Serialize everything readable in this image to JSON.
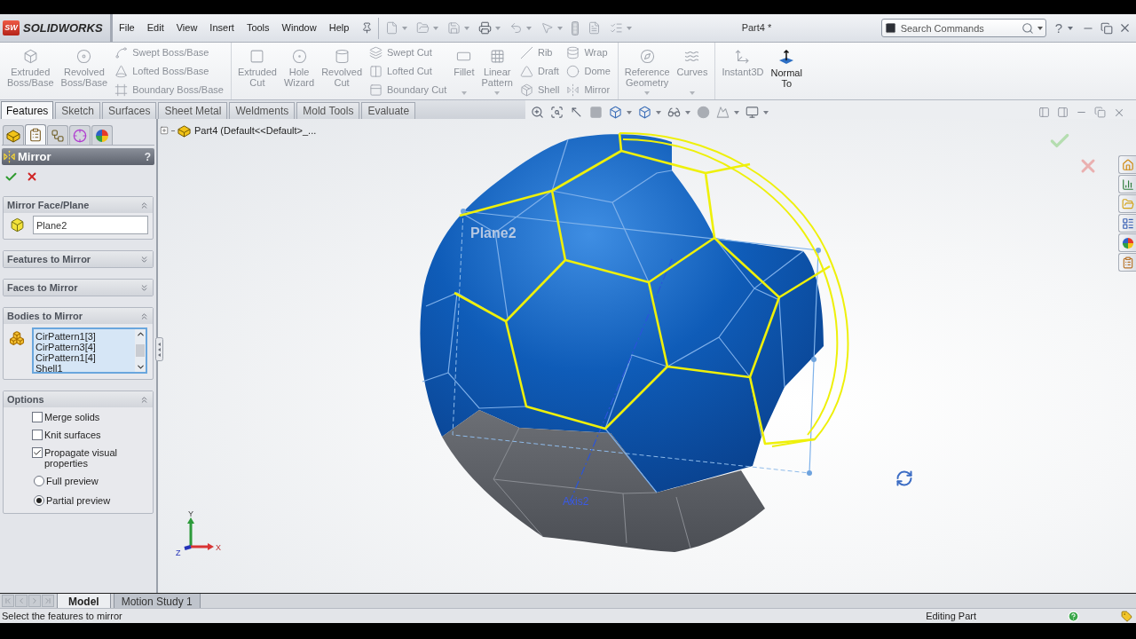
{
  "title_bar": {
    "logo_mark": "SW",
    "logo_text": "SOLIDWORKS",
    "menus": [
      "File",
      "Edit",
      "View",
      "Insert",
      "Tools",
      "Window",
      "Help"
    ],
    "document_title": "Part4 *",
    "search": {
      "placeholder": "Search Commands"
    },
    "help": "?"
  },
  "ribbon": {
    "sections": [
      {
        "columns": [
          {
            "kind": "large",
            "label": "Extruded Boss/Base",
            "disabled": true,
            "has_menu": false
          },
          {
            "kind": "large",
            "label": "Revolved Boss/Base",
            "disabled": true,
            "has_menu": false
          },
          {
            "kind": "stack",
            "items": [
              {
                "label": "Swept Boss/Base",
                "disabled": true
              },
              {
                "label": "Lofted Boss/Base",
                "disabled": true
              },
              {
                "label": "Boundary Boss/Base",
                "disabled": true
              }
            ]
          }
        ]
      },
      {
        "columns": [
          {
            "kind": "large",
            "label": "Extruded Cut",
            "disabled": true,
            "has_menu": false
          },
          {
            "kind": "large",
            "label": "Hole Wizard",
            "disabled": true,
            "has_menu": false
          },
          {
            "kind": "large",
            "label": "Revolved Cut",
            "disabled": true,
            "has_menu": false
          },
          {
            "kind": "stack",
            "items": [
              {
                "label": "Swept Cut",
                "disabled": true
              },
              {
                "label": "Lofted Cut",
                "disabled": true
              },
              {
                "label": "Boundary Cut",
                "disabled": true
              }
            ]
          },
          {
            "kind": "large",
            "label": "Fillet",
            "disabled": true,
            "has_menu": true
          },
          {
            "kind": "large",
            "label": "Linear Pattern",
            "disabled": true,
            "has_menu": true
          },
          {
            "kind": "stack",
            "items": [
              {
                "label": "Rib",
                "disabled": true
              },
              {
                "label": "Draft",
                "disabled": true
              },
              {
                "label": "Shell",
                "disabled": true
              }
            ]
          },
          {
            "kind": "stack",
            "items": [
              {
                "label": "Wrap",
                "disabled": true
              },
              {
                "label": "Dome",
                "disabled": true
              },
              {
                "label": "Mirror",
                "disabled": true
              }
            ]
          }
        ]
      },
      {
        "columns": [
          {
            "kind": "large",
            "label": "Reference Geometry",
            "disabled": true,
            "has_menu": true
          },
          {
            "kind": "large",
            "label": "Curves",
            "disabled": true,
            "has_menu": true
          }
        ]
      },
      {
        "columns": [
          {
            "kind": "large",
            "label": "Instant3D",
            "disabled": true,
            "has_menu": false
          },
          {
            "kind": "large",
            "label": "Normal To",
            "disabled": false,
            "has_menu": false
          }
        ]
      }
    ]
  },
  "command_tabs": [
    {
      "label": "Features",
      "selected": true
    },
    {
      "label": "Sketch",
      "selected": false
    },
    {
      "label": "Surfaces",
      "selected": false
    },
    {
      "label": "Sheet Metal",
      "selected": false
    },
    {
      "label": "Weldments",
      "selected": false
    },
    {
      "label": "Mold Tools",
      "selected": false
    },
    {
      "label": "Evaluate",
      "selected": false
    }
  ],
  "panel_tabs": [
    {
      "selected": false
    },
    {
      "selected": true
    },
    {
      "selected": false
    },
    {
      "selected": false
    },
    {
      "selected": false
    }
  ],
  "property_manager": {
    "title": "Mirror",
    "help": "?",
    "groups": [
      {
        "title": "Mirror Face/Plane",
        "expanded": true,
        "kind": "face_field",
        "value": "Plane2"
      },
      {
        "title": "Features to Mirror",
        "expanded": false
      },
      {
        "title": "Faces to Mirror",
        "expanded": false
      },
      {
        "title": "Bodies to Mirror",
        "expanded": true,
        "kind": "list",
        "items": [
          "CirPattern1[3]",
          "CirPattern3[4]",
          "CirPattern1[4]",
          "Shell1"
        ]
      },
      {
        "title": "Options",
        "expanded": true,
        "kind": "options",
        "options": [
          {
            "kind": "checkbox",
            "label": "Merge solids",
            "checked": false
          },
          {
            "kind": "checkbox",
            "label": "Knit surfaces",
            "checked": false
          },
          {
            "kind": "checkbox",
            "label": "Propagate visual properties",
            "checked": true
          },
          {
            "kind": "radio",
            "label": "Full preview",
            "selected": false
          },
          {
            "kind": "radio",
            "label": "Partial preview",
            "selected": true
          }
        ]
      }
    ]
  },
  "feature_tree": {
    "root": "Part4 (Default<<Default>_...",
    "expanded": false
  },
  "viewport": {
    "labels": [
      {
        "kind": "plane",
        "text": "Plane2"
      },
      {
        "kind": "axis",
        "text": "Axis2"
      }
    ],
    "triad": {
      "x": "X",
      "y": "Y",
      "z": "Z"
    }
  },
  "bottom_tabs": [
    {
      "label": "Model",
      "selected": true
    },
    {
      "label": "Motion Study 1",
      "selected": false
    }
  ],
  "status_bar": {
    "message": "Select the features to mirror",
    "mode": "Editing Part"
  }
}
